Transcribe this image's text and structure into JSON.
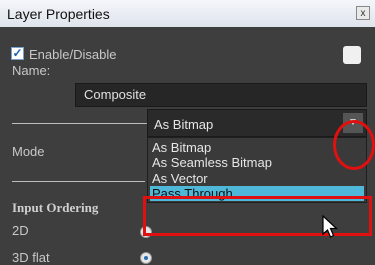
{
  "window": {
    "title": "Layer Properties",
    "close_glyph": "x"
  },
  "enable": {
    "label": "Enable/Disable",
    "checked": true,
    "check_glyph": "✓"
  },
  "name": {
    "label": "Name:",
    "value": "Composite"
  },
  "mode": {
    "label": "Mode",
    "value": "As Bitmap",
    "arrow_glyph": "▼",
    "options": [
      "As Bitmap",
      "As Seamless Bitmap",
      "As Vector",
      "Pass Through"
    ],
    "highlighted_option": "Pass Through"
  },
  "input_ordering": {
    "heading": "Input Ordering",
    "rows": [
      {
        "label": "2D"
      },
      {
        "label": "3D flat"
      }
    ]
  },
  "colors": {
    "highlight": "#4fb8d8",
    "annotation": "#e01010"
  }
}
